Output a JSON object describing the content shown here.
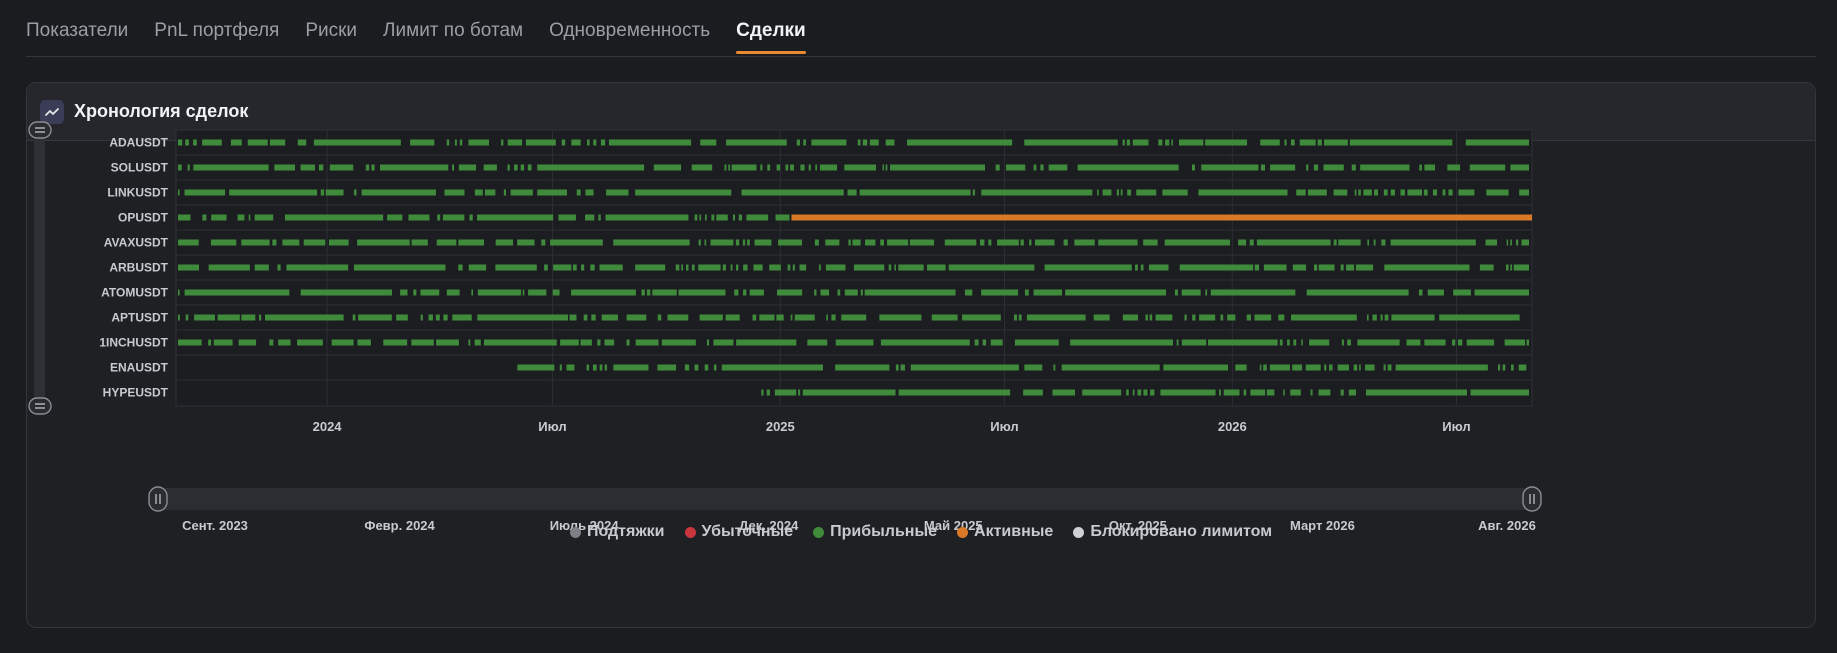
{
  "tabs": [
    {
      "label": "Показатели",
      "active": false
    },
    {
      "label": "PnL портфеля",
      "active": false
    },
    {
      "label": "Риски",
      "active": false
    },
    {
      "label": "Лимит по ботам",
      "active": false
    },
    {
      "label": "Одновременность",
      "active": false
    },
    {
      "label": "Сделки",
      "active": true
    }
  ],
  "card": {
    "title": "Хронология сделок",
    "icon": "line-chart-icon"
  },
  "chart_data": {
    "type": "timeline",
    "x_range": [
      "2023-09-01",
      "2026-08-31"
    ],
    "x_ticks": [
      {
        "date": "2024-01-01",
        "label": "2024"
      },
      {
        "date": "2024-07-01",
        "label": "Июл"
      },
      {
        "date": "2025-01-01",
        "label": "2025"
      },
      {
        "date": "2025-07-01",
        "label": "Июл"
      },
      {
        "date": "2026-01-01",
        "label": "2026"
      },
      {
        "date": "2026-07-01",
        "label": "Июл"
      }
    ],
    "symbols": [
      "ADAUSDT",
      "SOLUSDT",
      "LINKUSDT",
      "OPUSDT",
      "AVAXUSDT",
      "ARBUSDT",
      "ATOMUSDT",
      "APTUSDT",
      "1INCHUSDT",
      "ENAUSDT",
      "HYPEUSDT"
    ],
    "row_start": [
      "2023-09-01",
      "2023-09-01",
      "2023-09-01",
      "2023-09-01",
      "2023-09-01",
      "2023-09-01",
      "2023-09-01",
      "2023-09-01",
      "2023-09-01",
      "2024-06-01",
      "2024-12-15"
    ],
    "active_positions": [
      {
        "symbol": "OPUSDT",
        "start": "2025-01-10",
        "end": "2026-08-31"
      }
    ],
    "legend": [
      {
        "label": "Подтяжки",
        "color": "#7c7f86"
      },
      {
        "label": "Убыточные",
        "color": "#c9363e"
      },
      {
        "label": "Прибыльные",
        "color": "#3f8a3b"
      },
      {
        "label": "Активные",
        "color": "#d97826"
      },
      {
        "label": "Блокировано лимитом",
        "color": "#cfd1d6"
      }
    ],
    "grid": true
  },
  "slider": {
    "labels": [
      "Сент. 2023",
      "Февр. 2024",
      "Июль 2024",
      "Дек. 2024",
      "Май 2025",
      "Окт. 2025",
      "Март 2026",
      "Авг. 2026"
    ]
  },
  "colors": {
    "accent": "#e8882f",
    "profit": "#3f8a3b",
    "active": "#d97826"
  }
}
